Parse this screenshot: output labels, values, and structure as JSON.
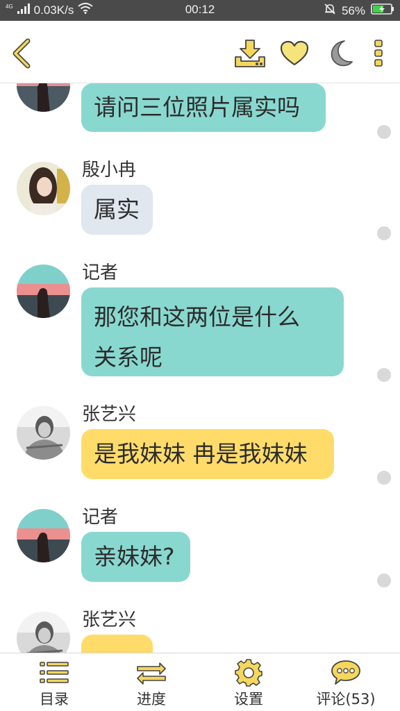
{
  "status_bar": {
    "network_tag": "4G",
    "speed": "0.03K/s",
    "time": "00:12",
    "battery": "56%"
  },
  "colors": {
    "accent": "#f5d75c",
    "bubble_teal": "#89d8d0",
    "bubble_gray": "#e0e7ef",
    "bubble_yellow": "#ffdb6a"
  },
  "toolbar": {
    "icons": [
      "back-arrow-icon",
      "download-icon",
      "heart-icon",
      "moon-icon",
      "more-vertical-icon"
    ]
  },
  "messages": [
    {
      "sender": "",
      "text": "请问三位照片属实吗",
      "style": "teal"
    },
    {
      "sender": "殷小冉",
      "text": "属实",
      "style": "gray"
    },
    {
      "sender": "记者",
      "text_line1": "那您和这两位是什么",
      "text_line2": "关系呢",
      "style": "teal"
    },
    {
      "sender": "张艺兴",
      "text": "是我妹妹 冉是我妹妹",
      "style": "yellow"
    },
    {
      "sender": "记者",
      "text": "亲妹妹?",
      "style": "teal"
    },
    {
      "sender": "张艺兴",
      "text": "",
      "style": "yellow"
    }
  ],
  "bottom_nav": [
    {
      "label": "目录",
      "icon": "list-icon"
    },
    {
      "label": "进度",
      "icon": "swap-arrows-icon"
    },
    {
      "label": "设置",
      "icon": "gear-icon"
    },
    {
      "label": "评论(53)",
      "icon": "comment-bubble-icon"
    }
  ]
}
